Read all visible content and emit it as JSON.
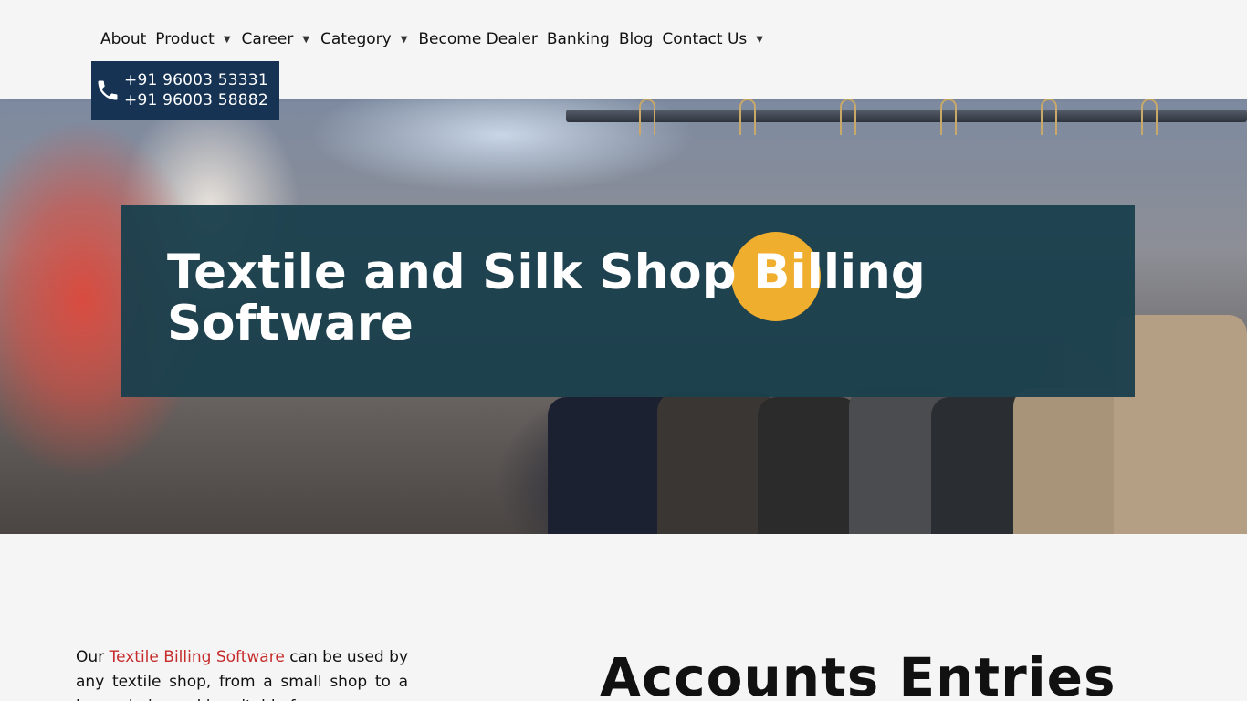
{
  "nav": {
    "items": [
      {
        "label": "About",
        "has_dropdown": false
      },
      {
        "label": "Product",
        "has_dropdown": true
      },
      {
        "label": "Career",
        "has_dropdown": true
      },
      {
        "label": "Category",
        "has_dropdown": true
      },
      {
        "label": "Become Dealer",
        "has_dropdown": false
      },
      {
        "label": "Banking",
        "has_dropdown": false
      },
      {
        "label": "Blog",
        "has_dropdown": false
      },
      {
        "label": "Contact Us",
        "has_dropdown": true
      }
    ],
    "caret": "▼"
  },
  "contact": {
    "phone_1": "+91 96003 53331",
    "phone_2": "+91 96003 58882",
    "icon": "phone-icon"
  },
  "hero": {
    "title": "Textile and Silk Shop Billing Software",
    "banner_color": "#1b404d",
    "accent_color": "#efae2e"
  },
  "intro": {
    "prefix": "Our ",
    "link_text": "Textile Billing Software",
    "suffix": " can be used by any textile shop, from a small shop to a large chain, and is suitable for"
  },
  "section": {
    "heading": "Accounts Entries"
  },
  "colors": {
    "phone_box": "#163354",
    "link": "#c62d2d",
    "background": "#f5f5f5"
  }
}
